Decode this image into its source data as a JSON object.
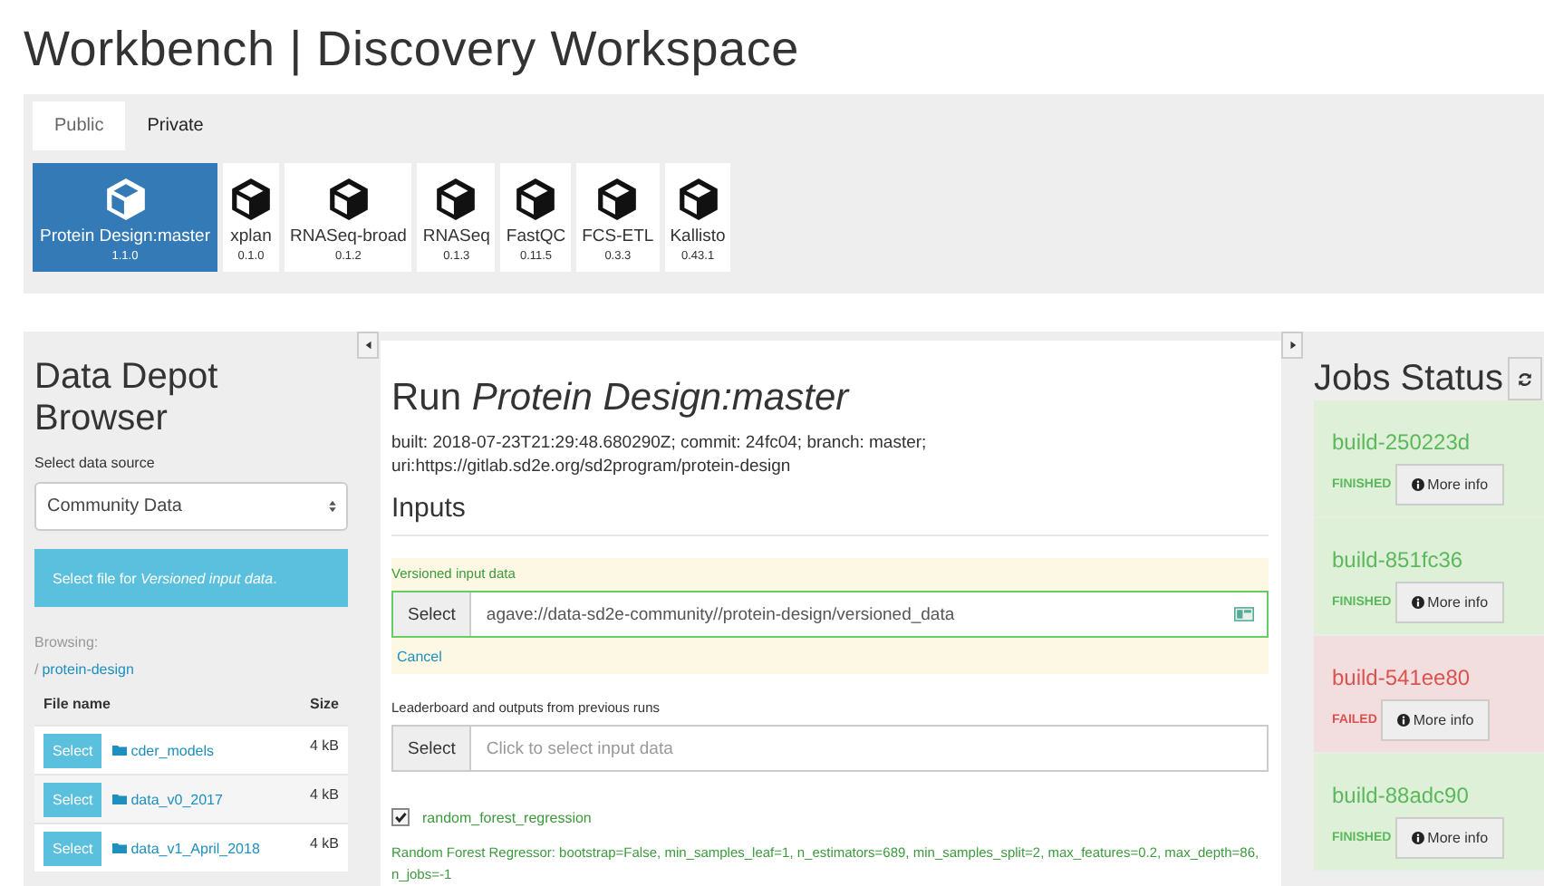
{
  "title": "Workbench | Discovery Workspace",
  "app_tabs": [
    {
      "label": "Public",
      "selected": true
    },
    {
      "label": "Private",
      "selected": false
    }
  ],
  "apps": [
    {
      "name": "Protein Design:master",
      "version": "1.1.0",
      "selected": true
    },
    {
      "name": "xplan",
      "version": "0.1.0",
      "selected": false
    },
    {
      "name": "RNASeq-broad",
      "version": "0.1.2",
      "selected": false
    },
    {
      "name": "RNASeq",
      "version": "0.1.3",
      "selected": false
    },
    {
      "name": "FastQC",
      "version": "0.11.5",
      "selected": false
    },
    {
      "name": "FCS-ETL",
      "version": "0.3.3",
      "selected": false
    },
    {
      "name": "Kallisto",
      "version": "0.43.1",
      "selected": false
    }
  ],
  "data_depot": {
    "title": "Data Depot Browser",
    "source_label": "Select data source",
    "source": "Community Data",
    "notice": "Select file for *Versioned input data*.",
    "browsing_label": "Browsing:",
    "path_sep": "/",
    "path": "protein-design",
    "columns": [
      "File name",
      "Size"
    ],
    "files": [
      {
        "action": "Select",
        "name": "cder_models",
        "size": "4 kB"
      },
      {
        "action": "Select",
        "name": "data_v0_2017",
        "size": "4 kB"
      },
      {
        "action": "Select",
        "name": "data_v1_April_2018",
        "size": "4 kB"
      }
    ]
  },
  "run": {
    "title_prefix": "Run",
    "app_name": "Protein Design:master",
    "meta": "built: 2018-07-23T21:29:48.680290Z; commit: 24fc04; branch: master; uri:https://gitlab.sd2e.org/sd2program/protein-design",
    "inputs_heading": "Inputs",
    "inputs": [
      {
        "label": "Versioned input data",
        "button": "Select",
        "value": "agave://data-sd2e-community//protein-design/versioned_data",
        "active": true,
        "cancel": "Cancel"
      },
      {
        "label": "Leaderboard and outputs from previous runs",
        "button": "Select",
        "placeholder": "Click to select input data",
        "active": false
      }
    ],
    "models": [
      {
        "name": "random_forest_regression",
        "checked": true,
        "description": "Random Forest Regressor: bootstrap=False, min_samples_leaf=1, n_estimators=689, min_samples_split=2, max_features=0.2, max_depth=86, n_jobs=-1"
      }
    ]
  },
  "jobs": {
    "title": "Jobs Status",
    "items": [
      {
        "name": "build-250223d",
        "status": "FINISHED",
        "kind": "finished",
        "button": "More info"
      },
      {
        "name": "build-851fc36",
        "status": "FINISHED",
        "kind": "finished",
        "button": "More info"
      },
      {
        "name": "build-541ee80",
        "status": "FAILED",
        "kind": "failed",
        "button": "More info"
      },
      {
        "name": "build-88adc90",
        "status": "FINISHED",
        "kind": "finished",
        "button": "More info"
      }
    ]
  }
}
